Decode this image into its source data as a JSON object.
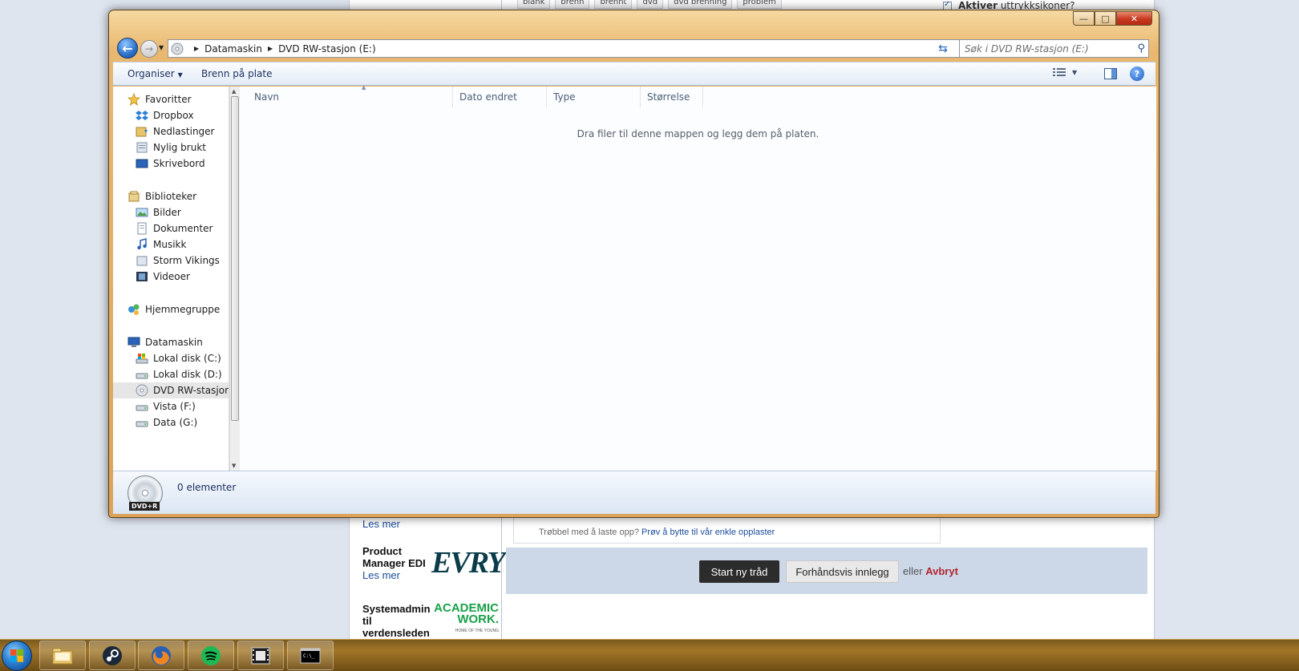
{
  "background": {
    "tags": [
      "blank",
      "brenn",
      "brennt",
      "dvd",
      "dvd brenning",
      "problem"
    ],
    "option_label_bold": "Aktiver",
    "option_label_rest": "uttrykksikoner?",
    "ads": [
      {
        "link": "Les mer"
      },
      {
        "title": "Product Manager EDI",
        "link": "Les mer",
        "logo": "EVRY"
      },
      {
        "title": "Systemadmin til verdensleden",
        "logo_line1": "ACADEMIC",
        "logo_line2": "WORK.",
        "logo_tagline": "HOME OF THE YOUNG PROFESSIONALS"
      }
    ],
    "upload_help_text": "Trøbbel med å laste opp?",
    "upload_help_link": "Prøv å bytte til vår enkle opplaster",
    "start_thread_button": "Start ny tråd",
    "preview_button": "Forhåndsvis innlegg",
    "or_text": "eller",
    "cancel_link": "Avbryt"
  },
  "explorer": {
    "controls": {
      "minimize": "—",
      "maximize": "□",
      "close": "✕"
    },
    "breadcrumb": [
      "Datamaskin",
      "DVD RW-stasjon (E:)"
    ],
    "search_placeholder": "Søk i DVD RW-stasjon (E:)",
    "toolbar": {
      "organize": "Organiser",
      "burn": "Brenn på plate"
    },
    "nav": {
      "favorites": {
        "label": "Favoritter",
        "items": [
          "Dropbox",
          "Nedlastinger",
          "Nylig brukt",
          "Skrivebord"
        ]
      },
      "libraries": {
        "label": "Biblioteker",
        "items": [
          "Bilder",
          "Dokumenter",
          "Musikk",
          "Storm Vikings",
          "Videoer"
        ]
      },
      "homegroup": {
        "label": "Hjemmegruppe"
      },
      "computer": {
        "label": "Datamaskin",
        "items": [
          "Lokal disk (C:)",
          "Lokal disk (D:)",
          "DVD RW-stasjon",
          "Vista (F:)",
          "Data (G:)"
        ],
        "selected": "DVD RW-stasjon"
      }
    },
    "columns": [
      "Navn",
      "Dato endret",
      "Type",
      "Størrelse"
    ],
    "empty_message": "Dra filer til denne mappen og legg dem på platen.",
    "status": {
      "count": "0 elementer",
      "drive_badge": "DVD+R"
    }
  },
  "taskbar": {
    "items": [
      "start-orb",
      "explorer-icon",
      "steam-icon",
      "firefox-icon",
      "spotify-icon",
      "media-player-icon",
      "command-prompt-icon"
    ]
  }
}
